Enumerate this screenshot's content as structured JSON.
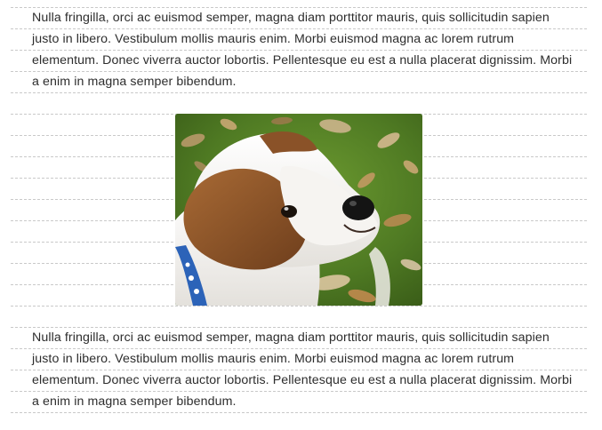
{
  "article": {
    "paragraph_top": "Nulla fringilla, orci ac euismod semper, magna diam porttitor mauris, quis sollicitudin sapien justo in libero. Vestibulum mollis mauris enim. Morbi euismod magna ac lorem rutrum elementum. Donec viverra auctor lobortis. Pellentesque eu est a nulla placerat dignissim. Morbi a enim in magna semper bibendum.",
    "paragraph_bottom": "Nulla fringilla, orci ac euismod semper, magna diam porttitor mauris, quis sollicitudin sapien justo in libero. Vestibulum mollis mauris enim. Morbi euismod magna ac lorem rutrum elementum. Donec viverra auctor lobortis. Pellentesque eu est a nulla placerat dignissim. Morbi a enim in magna semper bibendum."
  },
  "image": {
    "subject": "dog-photo",
    "colors": {
      "grass": "#4f7a23",
      "fur_white": "#f3f1ee",
      "fur_brown": "#8a5228",
      "collar": "#2c63b8"
    }
  },
  "colors": {
    "rule_line": "#c9c9c9",
    "text": "#2d2d2d"
  }
}
